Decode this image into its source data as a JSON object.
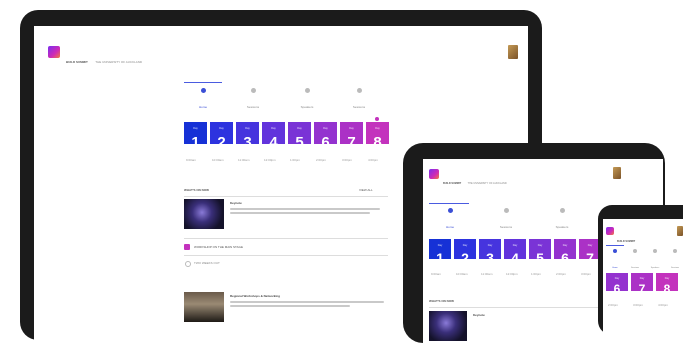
{
  "app": {
    "title": "BUILD SUMMIT",
    "subtitle": "THE UNIVERSITY OF AUCKLAND"
  },
  "tabs": [
    {
      "label": "Home",
      "icon": "home-icon"
    },
    {
      "label": "Sessions",
      "icon": "calendar-icon"
    },
    {
      "label": "Speakers",
      "icon": "people-icon"
    },
    {
      "label": "Sessions",
      "icon": "star-icon"
    }
  ],
  "days": [
    {
      "label": "Day",
      "num": "1"
    },
    {
      "label": "Day",
      "num": "2"
    },
    {
      "label": "Day",
      "num": "3"
    },
    {
      "label": "Day",
      "num": "4"
    },
    {
      "label": "Day",
      "num": "5"
    },
    {
      "label": "Day",
      "num": "6"
    },
    {
      "label": "Day",
      "num": "7"
    },
    {
      "label": "Day",
      "num": "8"
    }
  ],
  "day_colors": [
    "#1631d6",
    "#2d33df",
    "#4634de",
    "#6233dc",
    "#7a33d6",
    "#9432cf",
    "#ab31c6",
    "#c332bd"
  ],
  "times": [
    "9:00am",
    "10:00am",
    "11:00am",
    "12:00pm",
    "1:00pm",
    "2:00pm",
    "3:00pm",
    "4:00pm"
  ],
  "section": {
    "title": "WHAT'S ON NOW",
    "link": "VIEW ALL"
  },
  "events": [
    {
      "title": "Keynote"
    },
    {
      "title": "Regional Workshops & Networking"
    }
  ],
  "rows": [
    {
      "text": "WORKSHOP ON THE MAIN STAGE"
    },
    {
      "text": "TWO WEEKS OUT"
    }
  ],
  "colors": {
    "accent": "#c332bd",
    "primary": "#1631d6",
    "bezel": "#1b1b1b"
  }
}
